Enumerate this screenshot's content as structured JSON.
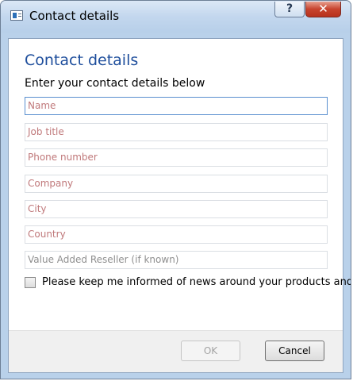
{
  "window": {
    "title": "Contact details",
    "help_glyph": "?",
    "close_glyph": "✕"
  },
  "form": {
    "heading": "Contact details",
    "subtitle": "Enter your contact details below",
    "fields": [
      {
        "placeholder": "Name",
        "value": ""
      },
      {
        "placeholder": "Job title",
        "value": ""
      },
      {
        "placeholder": "Phone number",
        "value": ""
      },
      {
        "placeholder": "Company",
        "value": ""
      },
      {
        "placeholder": "City",
        "value": ""
      },
      {
        "placeholder": "Country",
        "value": ""
      },
      {
        "placeholder": "Value Added Reseller (if known)",
        "value": ""
      }
    ],
    "checkbox_label": "Please keep me informed of news around your products and",
    "checkbox_checked": false
  },
  "buttons": {
    "ok_label": "OK",
    "cancel_label": "Cancel"
  },
  "colors": {
    "heading": "#1e4e9c",
    "placeholder_required": "#c0797b",
    "placeholder_optional": "#8f8f8f"
  }
}
